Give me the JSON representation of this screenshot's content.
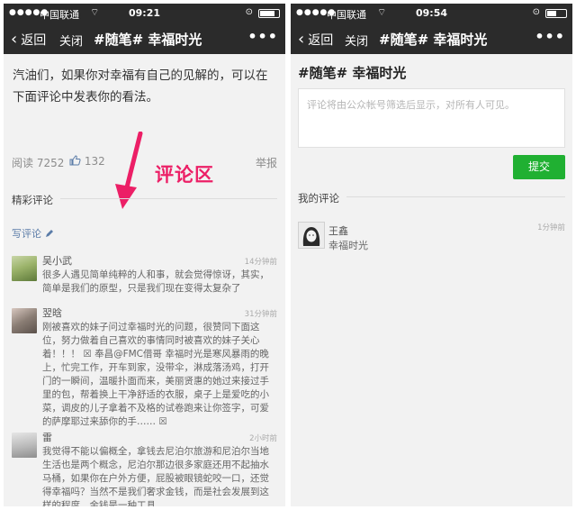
{
  "left": {
    "status": {
      "signal": "●●●●●",
      "carrier": "中国联通",
      "wifi": "⌔",
      "time": "09:21",
      "lock": "⊙"
    },
    "nav": {
      "back_label": "返回",
      "close_label": "关闭",
      "title": "#随笔# 幸福时光",
      "more_label": "•••"
    },
    "article": {
      "text": "汽油们，如果你对幸福有自己的见解的，可以在下面评论中发表你的看法。"
    },
    "meta": {
      "read_label": "阅读",
      "read_count": "7252",
      "like_count": "132",
      "report_label": "举报"
    },
    "annotation": {
      "text": "评论区"
    },
    "featured_label": "精彩评论",
    "write_label": "写评论",
    "comments": [
      {
        "name": "吴小武",
        "time": "14分钟前",
        "text": "很多人遇见简单纯粹的人和事，就会觉得惊讶，其实，简单是我们的原型，只是我们现在变得太复杂了"
      },
      {
        "name": "翌晗",
        "time": "31分钟前",
        "text": "刚被喜欢的妹子问过幸福时光的问题，很赞同下面这位，努力做着自己喜欢的事情同时被喜欢的妹子关心着！！！ ☒ 奉昌@FMC借哥 幸福时光是寒风暴雨的晚上，忙完工作，开车到家，没带伞，淋成落汤鸡，打开门的一瞬间，温暖扑面而来，美丽贤惠的她过来接过手里的包，帮着换上干净舒适的衣服，桌子上是爱吃的小菜，调皮的儿子拿着不及格的试卷跑来让你签字，可爱的萨摩耶过来舔你的手…… ☒"
      },
      {
        "name": "雷",
        "time": "2小时前",
        "text": "我觉得不能以偏概全，拿钱去尼泊尔旅游和尼泊尔当地生活也是两个概念，尼泊尔那边很多家庭还用不起抽水马桶，如果你在户外方便，屁股被眼镜蛇咬一口，还觉得幸福吗？当然不是我们奢求金钱，而是社会发展到这样的程度，金钱是一种工具"
      }
    ]
  },
  "right": {
    "status": {
      "signal": "●●●●●",
      "carrier": "中国联通",
      "wifi": "⌔",
      "time": "09:54",
      "lock": "⊙"
    },
    "nav": {
      "back_label": "返回",
      "close_label": "关闭",
      "title": "#随笔# 幸福时光",
      "more_label": "•••"
    },
    "page_title": "#随笔# 幸福时光",
    "comment_placeholder": "评论将由公众帐号筛选后显示，对所有人可见。",
    "submit_label": "提交",
    "my_comments_label": "我的评论",
    "my_comment": {
      "name": "王鑫",
      "text": "幸福时光",
      "time": "1分钟前"
    }
  },
  "colors": {
    "navbar": "#2b2b2b",
    "background": "#f2f2f2",
    "accent_green": "#20b032",
    "annotation_pink": "#ec1f66",
    "link_blue": "#5b7ca8"
  },
  "icons": {
    "back": "chevron-left-icon",
    "more": "more-dots-icon",
    "like": "thumbs-up-icon",
    "edit": "pencil-icon"
  }
}
